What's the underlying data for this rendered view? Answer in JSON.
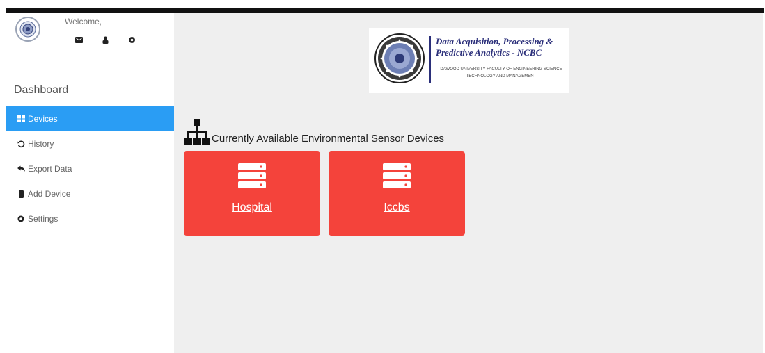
{
  "profile": {
    "welcome": "Welcome,",
    "icons": [
      "envelope-icon",
      "user-icon",
      "gear-icon"
    ]
  },
  "sidebar": {
    "title": "Dashboard",
    "items": [
      {
        "label": "Devices",
        "icon": "grid-icon",
        "active": true
      },
      {
        "label": "History",
        "icon": "history-icon",
        "active": false
      },
      {
        "label": "Export Data",
        "icon": "export-icon",
        "active": false
      },
      {
        "label": "Add Device",
        "icon": "mobile-icon",
        "active": false
      },
      {
        "label": "Settings",
        "icon": "gear-icon",
        "active": false
      }
    ]
  },
  "logo": {
    "title": "Data Acquisition, Processing & Predictive Analytics - NCBC",
    "subtitle": "Dawood University Faculty of Engineering Science Technology and Management"
  },
  "main": {
    "section_title": "Currently Available Environmental Sensor Devices",
    "section_icon": "sitemap-icon",
    "devices": [
      {
        "label": "Hospital",
        "icon": "server-icon"
      },
      {
        "label": "Iccbs",
        "icon": "server-icon"
      }
    ]
  },
  "colors": {
    "accent": "#2a9df4",
    "card": "#f4433b",
    "content_bg": "#efefef",
    "logo_text": "#2b2f7a"
  }
}
